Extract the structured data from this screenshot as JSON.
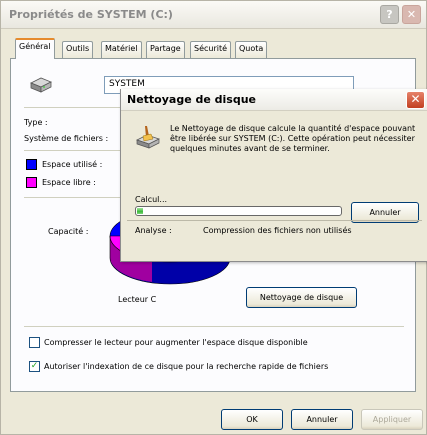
{
  "window": {
    "title": "Propriétés de SYSTEM (C:)",
    "help_label": "?",
    "close_label": "✕"
  },
  "tabs": [
    {
      "label": "Général",
      "active": true
    },
    {
      "label": "Outils"
    },
    {
      "label": "Matériel"
    },
    {
      "label": "Partage"
    },
    {
      "label": "Sécurité"
    },
    {
      "label": "Quota"
    }
  ],
  "general": {
    "volume_name": "SYSTEM",
    "type_label": "Type :",
    "fs_label": "Système de fichiers :",
    "used_label": "Espace utilisé :",
    "free_label": "Espace libre :",
    "capacity_label": "Capacité :",
    "drive_label": "Lecteur C",
    "cleanup_button": "Nettoyage de disque",
    "compress_label": "Compresser le lecteur pour augmenter l'espace disque disponible",
    "compress_checked": false,
    "index_label": "Autoriser l'indexation de ce disque pour la recherche rapide de fichiers",
    "index_checked": true,
    "used_color": "#0000ff",
    "free_color": "#ff00ff"
  },
  "buttons": {
    "ok": "OK",
    "cancel": "Annuler",
    "apply": "Appliquer"
  },
  "dialog": {
    "title": "Nettoyage de disque",
    "close_label": "✕",
    "message": "Le Nettoyage de disque calcule la quantité d'espace pouvant être libérée sur SYSTEM (C:). Cette opération peut nécessiter quelques minutes avant de se terminer.",
    "calc_label": "Calcul...",
    "cancel_button": "Annuler",
    "analysis_label": "Analyse :",
    "analysis_value": "Compression des fichiers non utilisés",
    "progress_fraction": 0.04
  }
}
